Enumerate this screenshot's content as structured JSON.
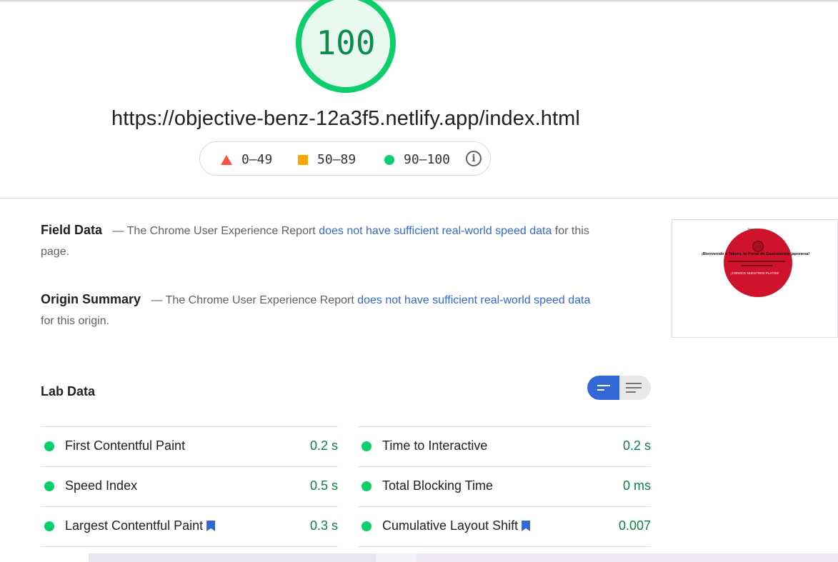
{
  "score": {
    "value": "100",
    "color": "#0cce6b"
  },
  "url": "https://objective-benz-12a3f5.netlify.app/index.html",
  "legend": {
    "fail": "0–49",
    "average": "50–89",
    "pass": "90–100",
    "info_icon": "i"
  },
  "field_data": {
    "title": "Field Data",
    "dash": "—",
    "text_before": "The Chrome User Experience Report",
    "link": "does not have sufficient real-world speed data",
    "text_after": "for this page."
  },
  "origin_summary": {
    "title": "Origin Summary",
    "dash": "—",
    "text_before": "The Chrome User Experience Report",
    "link": "does not have sufficient real-world speed data",
    "text_after": "for this origin."
  },
  "thumbnail": {
    "headline": "¡Bienvenido a Takeru, tu Portal de Gastronomía japonesa!",
    "cta": "¡CONOCE NUESTROS PLATOS!",
    "small_top": "Takeru",
    "circle_color": "#d0132d"
  },
  "lab_data": {
    "title": "Lab Data",
    "left": [
      {
        "label": "First Contentful Paint",
        "value": "0.2 s",
        "bookmark": false
      },
      {
        "label": "Speed Index",
        "value": "0.5 s",
        "bookmark": false
      },
      {
        "label": "Largest Contentful Paint",
        "value": "0.3 s",
        "bookmark": true
      }
    ],
    "right": [
      {
        "label": "Time to Interactive",
        "value": "0.2 s",
        "bookmark": false
      },
      {
        "label": "Total Blocking Time",
        "value": "0 ms",
        "bookmark": false
      },
      {
        "label": "Cumulative Layout Shift",
        "value": "0.007",
        "bookmark": true
      }
    ]
  }
}
